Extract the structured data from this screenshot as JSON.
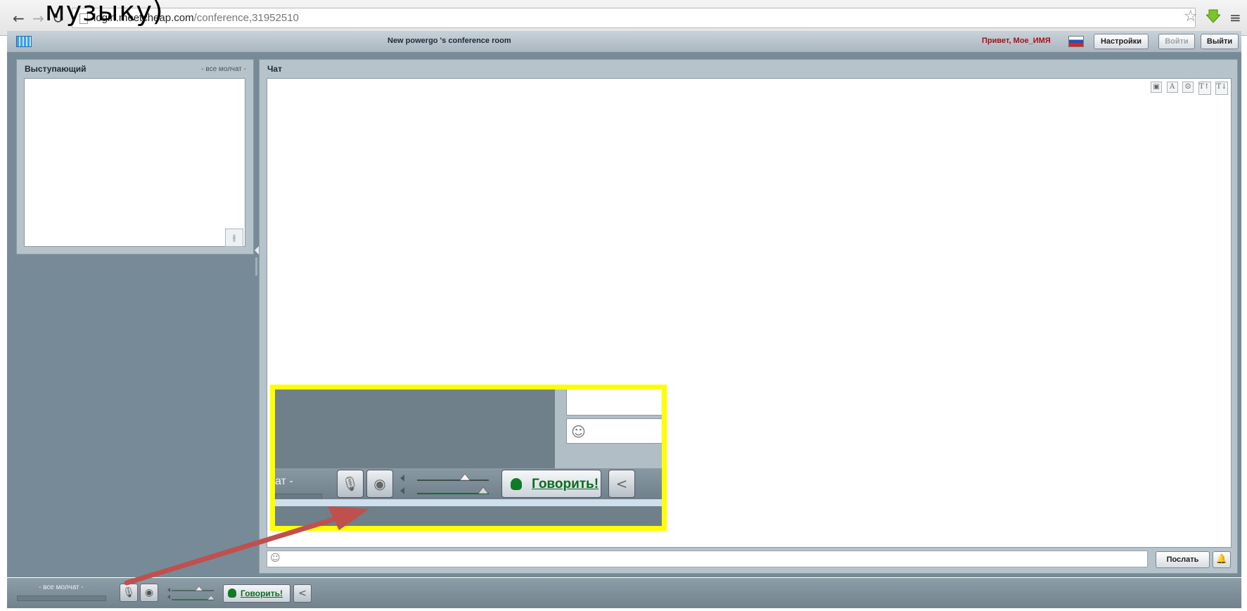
{
  "browser": {
    "url_host": "login.meetcheap.com",
    "url_path": "/conference,31952510",
    "back_glyph": "←",
    "forward_glyph": "→",
    "reload_glyph": "↻",
    "star_glyph": "☆",
    "menu_glyph": "≡"
  },
  "overlay_text": "музыку)",
  "header": {
    "title": "New powergo 's conference room",
    "greeting": "Привет, Мое_ИМЯ",
    "settings": "Настройки",
    "login": "Войти",
    "logout": "Выйти"
  },
  "speaker_panel": {
    "title": "Выступающий",
    "status": "- все молчат -",
    "eq_glyph": "⫲"
  },
  "chat_panel": {
    "title": "Чат",
    "tools": [
      "▣",
      "A",
      "☺",
      "T↑",
      "T↓"
    ],
    "send": "Послать",
    "bell_glyph": "🔔",
    "smile_glyph": "☺"
  },
  "bottom_toolbar": {
    "status": "- все молчат -",
    "mic_glyph": "🎙",
    "cam_glyph": "◉",
    "speak": "Говорить!",
    "share_glyph": "<"
  },
  "callout": {
    "status_fragment": "ат -",
    "speak": "Говорить!"
  },
  "colors": {
    "highlight": "#ffff00",
    "arrow": "#c0504d",
    "speak_green": "#0c6b1f",
    "greeting_red": "#a11414"
  }
}
